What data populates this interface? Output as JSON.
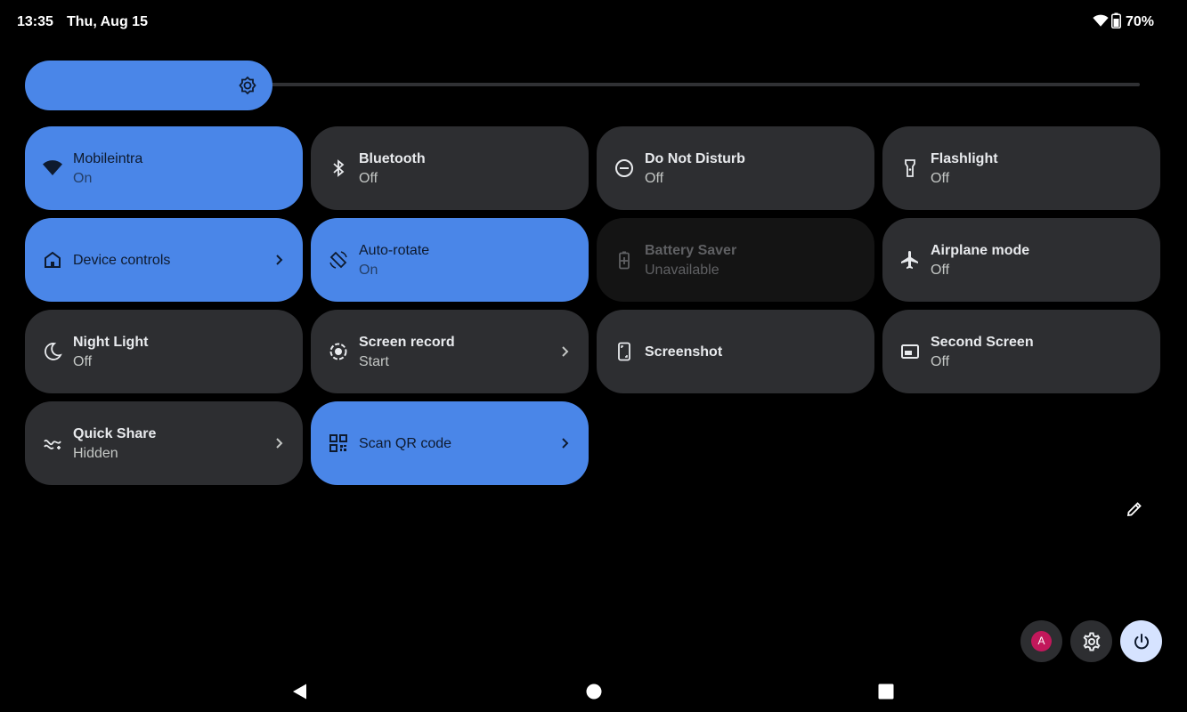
{
  "status_bar": {
    "time": "13:35",
    "date": "Thu, Aug 15",
    "battery": "70%",
    "icons": [
      "wifi-icon",
      "battery-icon"
    ]
  },
  "brightness": {
    "level": 0.21,
    "icon": "brightness-icon"
  },
  "tiles": [
    {
      "label": "Mobileintra",
      "sub": "On",
      "icon": "wifi-icon",
      "state": "active"
    },
    {
      "label": "Bluetooth",
      "sub": "Off",
      "icon": "bluetooth-icon",
      "state": "inactive"
    },
    {
      "label": "Do Not Disturb",
      "sub": "Off",
      "icon": "do-not-disturb-icon",
      "state": "inactive"
    },
    {
      "label": "Flashlight",
      "sub": "Off",
      "icon": "flashlight-icon",
      "state": "inactive"
    },
    {
      "label": "Device controls",
      "sub": "",
      "icon": "home-icon",
      "state": "active",
      "chevron": true
    },
    {
      "label": "Auto-rotate",
      "sub": "On",
      "icon": "auto-rotate-icon",
      "state": "active"
    },
    {
      "label": "Battery Saver",
      "sub": "Unavailable",
      "icon": "battery-saver-icon",
      "state": "disabled"
    },
    {
      "label": "Airplane mode",
      "sub": "Off",
      "icon": "airplane-icon",
      "state": "inactive"
    },
    {
      "label": "Night Light",
      "sub": "Off",
      "icon": "moon-icon",
      "state": "inactive"
    },
    {
      "label": "Screen record",
      "sub": "Start",
      "icon": "screen-record-icon",
      "state": "inactive",
      "chevron": true
    },
    {
      "label": "Screenshot",
      "sub": "",
      "icon": "screenshot-icon",
      "state": "inactive"
    },
    {
      "label": "Second Screen",
      "sub": "Off",
      "icon": "second-screen-icon",
      "state": "inactive"
    },
    {
      "label": "Quick Share",
      "sub": "Hidden",
      "icon": "quick-share-icon",
      "state": "inactive",
      "chevron": true
    },
    {
      "label": "Scan QR code",
      "sub": "",
      "icon": "qr-code-icon",
      "state": "active",
      "chevron": true
    }
  ],
  "edit": {
    "icon": "pencil-icon"
  },
  "actions": {
    "user_initial": "A",
    "user_color": "#c2185b",
    "settings_icon": "gear-icon",
    "power_icon": "power-icon"
  },
  "nav": {
    "back_icon": "back-icon",
    "home_icon": "home-circle-icon",
    "recents_icon": "recents-icon"
  },
  "colors": {
    "background": "#000000",
    "accent": "#4a86e8",
    "tile_inactive": "#2d2e31",
    "tile_disabled": "#141414",
    "power_button": "#d6e3ff"
  }
}
